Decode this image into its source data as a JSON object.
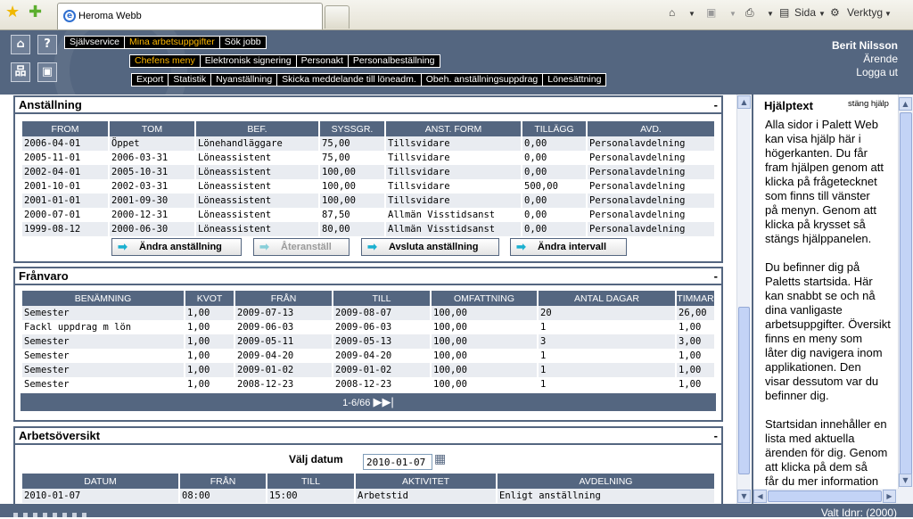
{
  "browser": {
    "tab_title": "Heroma Webb",
    "toolbar": {
      "page_label": "Sida",
      "tools_label": "Verktyg"
    }
  },
  "menus": {
    "main": [
      "Självservice",
      "Mina arbetsuppgifter",
      "Sök jobb"
    ],
    "main_selected": 1,
    "sub": [
      "Chefens meny",
      "Elektronisk signering",
      "Personakt",
      "Personalbeställning"
    ],
    "sub_selected": 0,
    "actions": [
      "Export",
      "Statistik",
      "Nyanställning",
      "Skicka meddelande till löneadm.",
      "Obeh. anställningsuppdrag",
      "Lönesättning"
    ]
  },
  "user": {
    "name": "Berit Nilsson",
    "link1": "Ärende",
    "link2": "Logga ut"
  },
  "anstallning": {
    "title": "Anställning",
    "collapse": "-",
    "columns": [
      "FROM",
      "TOM",
      "BEF.",
      "SYSSGR.",
      "ANST. FORM",
      "TILLÄGG",
      "AVD."
    ],
    "rows": [
      [
        "2006-04-01",
        "Öppet",
        "Lönehandläggare",
        "75,00",
        "Tillsvidare",
        "0,00",
        "Personalavdelning"
      ],
      [
        "2005-11-01",
        "2006-03-31",
        "Löneassistent",
        "75,00",
        "Tillsvidare",
        "0,00",
        "Personalavdelning"
      ],
      [
        "2002-04-01",
        "2005-10-31",
        "Löneassistent",
        "100,00",
        "Tillsvidare",
        "0,00",
        "Personalavdelning"
      ],
      [
        "2001-10-01",
        "2002-03-31",
        "Löneassistent",
        "100,00",
        "Tillsvidare",
        "500,00",
        "Personalavdelning"
      ],
      [
        "2001-01-01",
        "2001-09-30",
        "Löneassistent",
        "100,00",
        "Tillsvidare",
        "0,00",
        "Personalavdelning"
      ],
      [
        "2000-07-01",
        "2000-12-31",
        "Löneassistent",
        "87,50",
        "Allmän Visstidsanst",
        "0,00",
        "Personalavdelning"
      ],
      [
        "1999-08-12",
        "2000-06-30",
        "Löneassistent",
        "80,00",
        "Allmän Visstidsanst",
        "0,00",
        "Personalavdelning"
      ]
    ],
    "buttons": [
      "Ändra anställning",
      "Återanställ",
      "Avsluta anställning",
      "Ändra intervall"
    ]
  },
  "franvaro": {
    "title": "Frånvaro",
    "collapse": "-",
    "columns": [
      "BENÄMNING",
      "KVOT",
      "FRÅN",
      "TILL",
      "OMFATTNING",
      "ANTAL DAGAR",
      "TIMMAR"
    ],
    "rows": [
      [
        "Semester",
        "1,00",
        "2009-07-13",
        "2009-08-07",
        "100,00",
        "20",
        "26,00"
      ],
      [
        "Fackl uppdrag m lön",
        "1,00",
        "2009-06-03",
        "2009-06-03",
        "100,00",
        "1",
        "1,00"
      ],
      [
        "Semester",
        "1,00",
        "2009-05-11",
        "2009-05-13",
        "100,00",
        "3",
        "3,00"
      ],
      [
        "Semester",
        "1,00",
        "2009-04-20",
        "2009-04-20",
        "100,00",
        "1",
        "1,00"
      ],
      [
        "Semester",
        "1,00",
        "2009-01-02",
        "2009-01-02",
        "100,00",
        "1",
        "1,00"
      ],
      [
        "Semester",
        "1,00",
        "2008-12-23",
        "2008-12-23",
        "100,00",
        "1",
        "1,00"
      ]
    ],
    "pager": "1-6/66"
  },
  "arbetsoversikt": {
    "title": "Arbetsöversikt",
    "collapse": "-",
    "date_label": "Välj datum",
    "date_value": "2010-01-07",
    "columns": [
      "DATUM",
      "FRÅN",
      "TILL",
      "AKTIVITET",
      "AVDELNING"
    ],
    "rows": [
      [
        "2010-01-07",
        "08:00",
        "15:00",
        "Arbetstid",
        "Enligt anställning"
      ]
    ]
  },
  "help": {
    "title": "Hjälptext",
    "close": "stäng hjälp",
    "paragraphs": [
      "Alla sidor i Palett Web\nkan visa hjälp här i\nhögerkanten. Du får\nfram hjälpen genom att\nklicka på frågetecknet\nsom finns till vänster\npå menyn. Genom att\nklicka på krysset så\nstängs hjälppanelen.",
      "Du befinner dig på\nPaletts startsida. Här\nkan snabbt se och nå\ndina vanligaste\narbetsuppgifter. Översikt\nfinns en meny som\nlåter dig navigera inom\napplikationen. Den\nvisar dessutom var du\nbefinner dig.",
      "Startsidan innehåller en\nlista med aktuella\närenden för dig. Genom\natt klicka på dem så\nfår du mer information"
    ]
  },
  "status": {
    "selected": "Valt Idnr: (2000)"
  }
}
